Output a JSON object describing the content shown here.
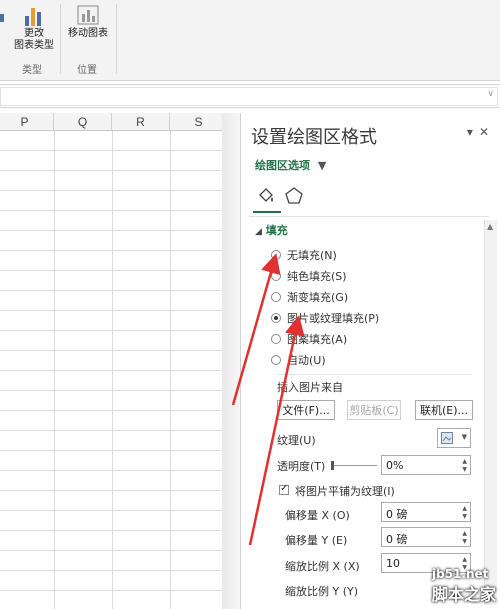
{
  "ribbon": {
    "change_chart_type": "更改\n图表类型",
    "change_chart_type_line1": "更改",
    "change_chart_type_line2": "图表类型",
    "move_chart": "移动图表",
    "group_type": "类型",
    "group_location": "位置"
  },
  "grid": {
    "columns": [
      "P",
      "Q",
      "R",
      "S"
    ]
  },
  "pane": {
    "title": "设置绘图区格式",
    "options_label": "绘图区选项",
    "fill_section": "填充",
    "fill_options": [
      {
        "label": "无填充(N)",
        "selected": false
      },
      {
        "label": "纯色填充(S)",
        "selected": false
      },
      {
        "label": "渐变填充(G)",
        "selected": false
      },
      {
        "label": "图片或纹理填充(P)",
        "selected": true
      },
      {
        "label": "图案填充(A)",
        "selected": false
      },
      {
        "label": "自动(U)",
        "selected": false
      }
    ],
    "insert_from": "插入图片来自",
    "file_button": "文件(F)...",
    "clipboard_button": "剪贴板(C)",
    "online_button": "联机(E)...",
    "texture_label": "纹理(U)",
    "transparency_label": "透明度(T)",
    "transparency_value": "0%",
    "tile_checkbox": "将图片平铺为纹理(I)",
    "tile_checked": true,
    "offset_x_label": "偏移量 X (O)",
    "offset_x_value": "0 磅",
    "offset_y_label": "偏移量 Y (E)",
    "offset_y_value": "0 磅",
    "scale_x_label": "缩放比例 X (X)",
    "scale_x_value": "10",
    "scale_y_label": "缩放比例 Y (Y)"
  },
  "watermark": {
    "url": "jb51.net",
    "name": "脚本之家"
  },
  "colors": {
    "accent": "#217346",
    "arrow": "#e03030"
  }
}
